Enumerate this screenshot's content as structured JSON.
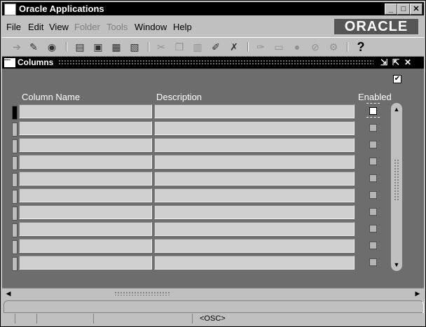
{
  "window": {
    "title": "Oracle Applications",
    "minimize": "_",
    "maximize": "□",
    "close": "✕"
  },
  "menu": [
    {
      "label": "File",
      "enabled": true
    },
    {
      "label": "Edit",
      "enabled": true
    },
    {
      "label": "View",
      "enabled": true
    },
    {
      "label": "Folder",
      "enabled": false
    },
    {
      "label": "Tools",
      "enabled": false
    },
    {
      "label": "Window",
      "enabled": true
    },
    {
      "label": "Help",
      "enabled": true
    }
  ],
  "logo": "ORACLE",
  "toolbar": {
    "help_glyph": "?"
  },
  "form": {
    "title": "Columns",
    "columns": {
      "name": "Column Name",
      "description": "Description",
      "enabled": "Enabled"
    }
  },
  "status": {
    "text": "<OSC>"
  },
  "colors": {
    "title_bar": "#000000",
    "form_background": "#6d6d6d",
    "field": "#d0d0d0",
    "chrome": "#c0c0c0"
  }
}
